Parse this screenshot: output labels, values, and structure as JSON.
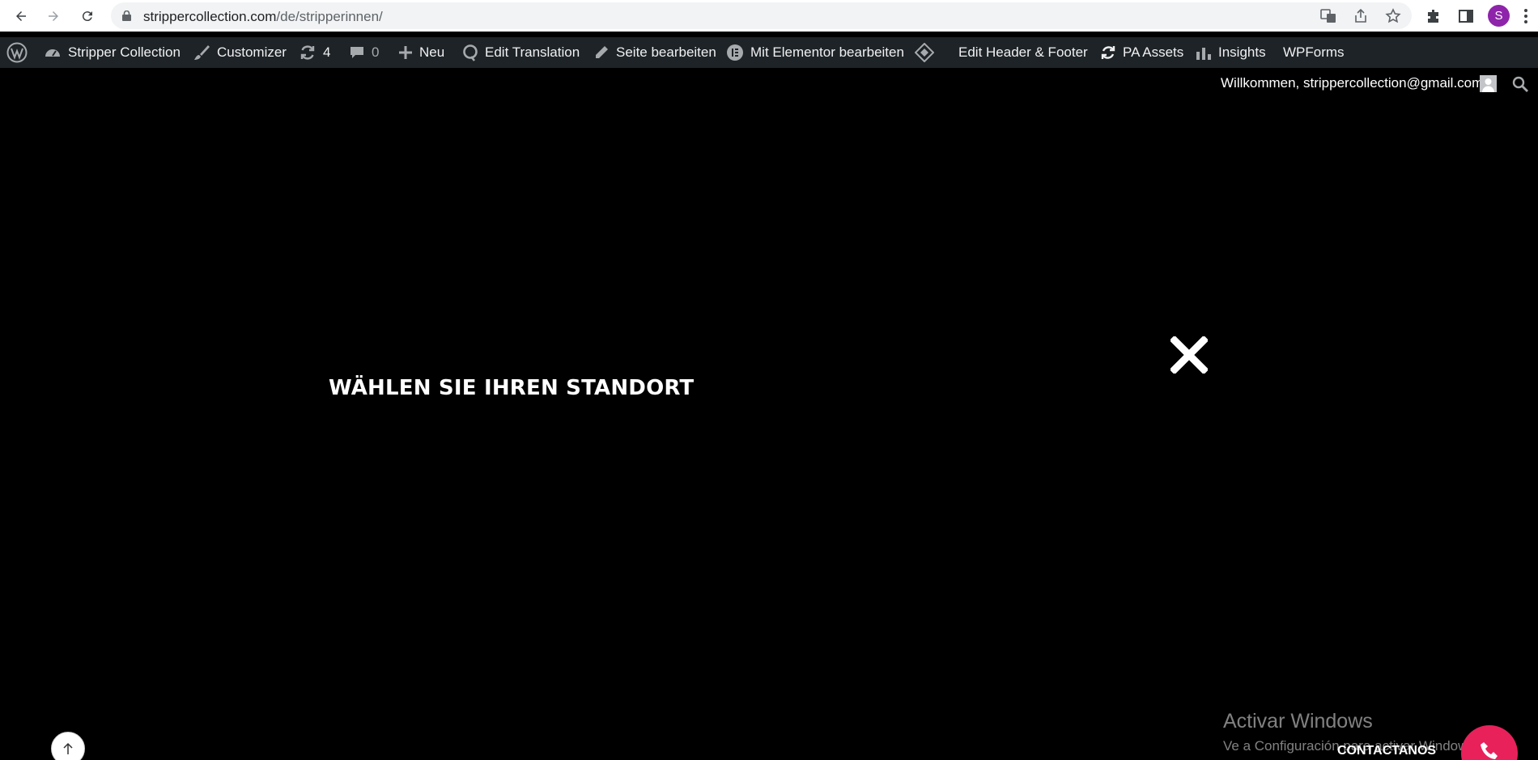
{
  "browser": {
    "url_host": "strippercollection.com",
    "url_path": "/de/stripperinnen/",
    "profile_initial": "S"
  },
  "adminbar": {
    "site_name": "Stripper Collection",
    "customizer": "Customizer",
    "updates_count": "4",
    "comments_count": "0",
    "new": "Neu",
    "edit_translation": "Edit Translation",
    "edit_page": "Seite bearbeiten",
    "elementor": "Mit Elementor bearbeiten",
    "header_footer": "Edit Header & Footer",
    "pa_assets": "PA Assets",
    "insights": "Insights",
    "wpforms": "WPForms"
  },
  "page": {
    "welcome": "Willkommen, strippercollection@gmail.com",
    "heading": "WÄHLEN SIE IHREN STANDORT",
    "contact_label": "CONTACTANOS"
  },
  "windows_watermark": {
    "title": "Activar Windows",
    "subtitle": "Ve a Configuración para activar Windows."
  },
  "colors": {
    "adminbar_bg": "#1d2327",
    "page_bg": "#000000",
    "contact_button": "#e8215b",
    "profile": "#8e24aa"
  }
}
